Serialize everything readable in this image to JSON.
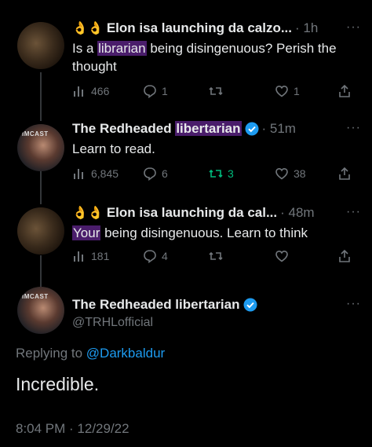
{
  "tweets": [
    {
      "emoji": "👌👌",
      "name": "Elon isa launching da calzo...",
      "time": "· 1h",
      "more": "···",
      "text_parts": [
        "Is a ",
        "librarian",
        " being disingenuous? Perish the thought"
      ],
      "views": "466",
      "replies": "1",
      "retweets": "",
      "likes": "1"
    },
    {
      "avatar_label": "IMCAST",
      "name_plain": "The Redheaded ",
      "name_hl": "libertarian",
      "time": "· 51m",
      "more": "···",
      "text": "Learn to read.",
      "views": "6,845",
      "replies": "6",
      "retweets": "3",
      "likes": "38"
    },
    {
      "emoji": "👌👌",
      "name": "Elon isa launching da cal...",
      "time": "· 48m",
      "more": "···",
      "text_parts": [
        "Your",
        " being disingenuous. Learn to think"
      ],
      "views": "181",
      "replies": "4",
      "retweets": "",
      "likes": ""
    }
  ],
  "main_tweet": {
    "avatar_label": "IMCAST",
    "name": "The Redheaded libertarian",
    "handle": "@TRHLofficial",
    "more": "···",
    "replying_prefix": "Replying to ",
    "replying_to": "@Darkbaldur",
    "text": "Incredible.",
    "timestamp": "8:04 PM · 12/29/22"
  },
  "colors": {
    "background": "#000000",
    "text": "#e7e9ea",
    "muted": "#71767b",
    "link": "#1d9bf0",
    "retweet_active": "#00ba7c",
    "highlight": "#4a1d6b"
  },
  "icons": [
    "views-icon",
    "reply-icon",
    "retweet-icon",
    "like-icon",
    "share-icon",
    "verified-icon",
    "more-icon"
  ]
}
